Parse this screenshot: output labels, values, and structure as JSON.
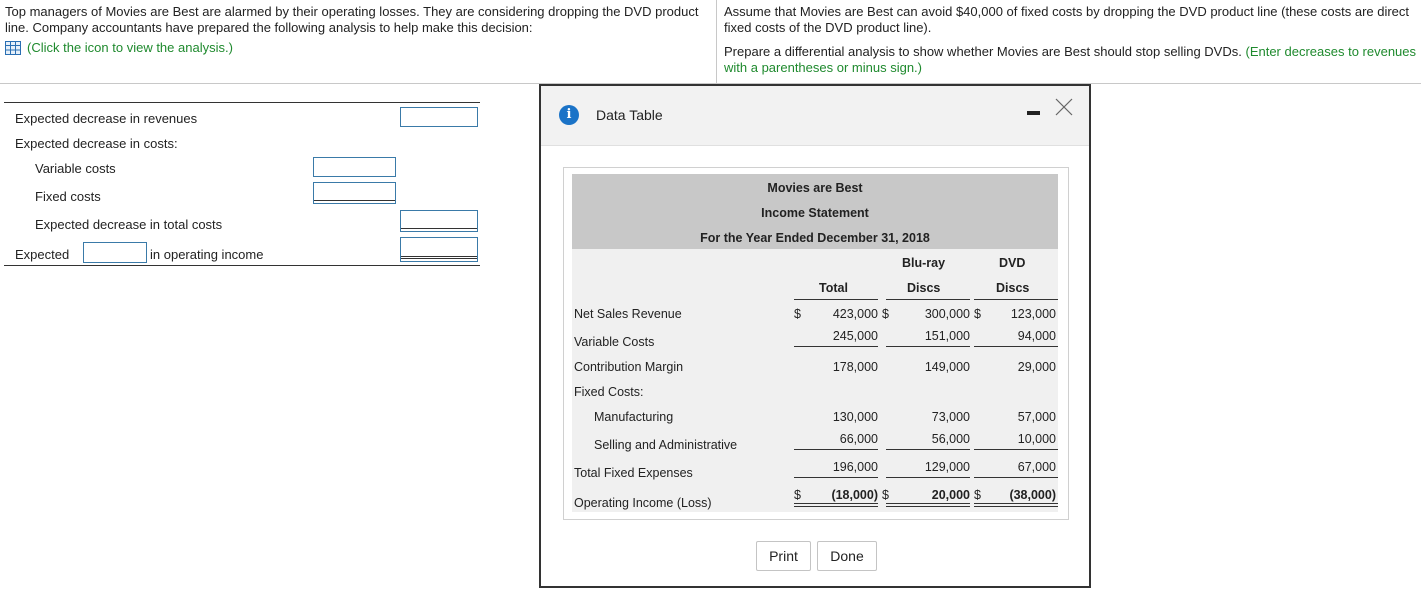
{
  "problem": {
    "intro_line1": "Top managers of Movies are Best are alarmed by their operating losses. They are considering dropping the DVD product",
    "intro_line2": "line. Company accountants have prepared the following analysis to help make this decision:",
    "view_link": "(Click the icon to view the analysis.)",
    "assume_line1": "Assume that Movies are Best can avoid $40,000 of fixed costs by dropping the DVD product line (these costs are direct",
    "assume_line2": "fixed costs of the DVD product line).",
    "prepare_text": "Prepare a differential analysis to show whether Movies are Best should stop selling DVDs.",
    "prepare_hint_part1": "(Enter decreases to revenues",
    "prepare_hint_part2": "with a parentheses or minus sign.)"
  },
  "analysis": {
    "revenues_label": "Expected decrease in revenues",
    "costs_label": "Expected decrease in costs:",
    "variable_label": "Variable costs",
    "fixed_label": "Fixed costs",
    "total_costs_label": "Expected decrease in total costs",
    "expected_label": "Expected",
    "operating_income_label": "in operating income"
  },
  "modal": {
    "title": "Data Table",
    "print_label": "Print",
    "done_label": "Done"
  },
  "statement": {
    "company": "Movies are Best",
    "name": "Income Statement",
    "period": "For the Year Ended December 31, 2018",
    "col_bluray_1": "Blu-ray",
    "col_dvd_1": "DVD",
    "col_total": "Total",
    "col_bluray_2": "Discs",
    "col_dvd_2": "Discs",
    "dollar": "$",
    "rows": [
      {
        "label": "Net Sales Revenue",
        "total": "423,000",
        "bluray": "300,000",
        "dvd": "123,000"
      },
      {
        "label": "Variable Costs",
        "total": "245,000",
        "bluray": "151,000",
        "dvd": "94,000"
      },
      {
        "label": "Contribution Margin",
        "total": "178,000",
        "bluray": "149,000",
        "dvd": "29,000"
      },
      {
        "label": "Fixed Costs:"
      },
      {
        "label": "Manufacturing",
        "total": "130,000",
        "bluray": "73,000",
        "dvd": "57,000"
      },
      {
        "label": "Selling and Administrative",
        "total": "66,000",
        "bluray": "56,000",
        "dvd": "10,000"
      },
      {
        "label": "Total Fixed Expenses",
        "total": "196,000",
        "bluray": "129,000",
        "dvd": "67,000"
      },
      {
        "label": "Operating Income (Loss)",
        "total": "(18,000)",
        "bluray": "20,000",
        "dvd": "(38,000)"
      }
    ]
  }
}
